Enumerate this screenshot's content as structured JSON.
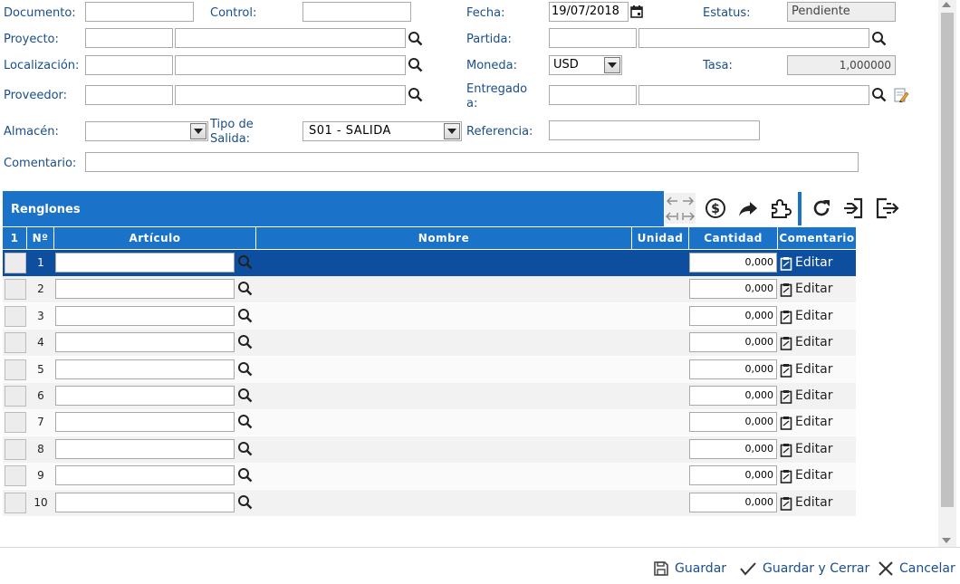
{
  "form": {
    "documento_label": "Documento:",
    "control_label": "Control:",
    "fecha_label": "Fecha:",
    "fecha_value": "19/07/2018",
    "estatus_label": "Estatus:",
    "estatus_value": "Pendiente",
    "proyecto_label": "Proyecto:",
    "partida_label": "Partida:",
    "localizacion_label": "Localización:",
    "moneda_label": "Moneda:",
    "moneda_value": "USD",
    "tasa_label": "Tasa:",
    "tasa_value": "1,000000",
    "proveedor_label": "Proveedor:",
    "entregado_label_1": "Entregado",
    "entregado_label_2": "a:",
    "almacen_label": "Almacén:",
    "tipo_salida_label_1": "Tipo de",
    "tipo_salida_label_2": "Salida:",
    "tipo_salida_value": "S01 - SALIDA",
    "referencia_label": "Referencia:",
    "comentario_label": "Comentario:"
  },
  "grid": {
    "title": "Renglones",
    "columns": {
      "sel": "1",
      "num": "Nº",
      "articulo": "Artículo",
      "nombre": "Nombre",
      "unidad": "Unidad",
      "cantidad": "Cantidad",
      "comentario": "Comentario"
    },
    "rows": [
      {
        "num": "1",
        "cantidad": "0,000",
        "edit": "Editar"
      },
      {
        "num": "2",
        "cantidad": "0,000",
        "edit": "Editar"
      },
      {
        "num": "3",
        "cantidad": "0,000",
        "edit": "Editar"
      },
      {
        "num": "4",
        "cantidad": "0,000",
        "edit": "Editar"
      },
      {
        "num": "5",
        "cantidad": "0,000",
        "edit": "Editar"
      },
      {
        "num": "6",
        "cantidad": "0,000",
        "edit": "Editar"
      },
      {
        "num": "7",
        "cantidad": "0,000",
        "edit": "Editar"
      },
      {
        "num": "8",
        "cantidad": "0,000",
        "edit": "Editar"
      },
      {
        "num": "9",
        "cantidad": "0,000",
        "edit": "Editar"
      },
      {
        "num": "10",
        "cantidad": "0,000",
        "edit": "Editar"
      }
    ]
  },
  "footer": {
    "guardar": "Guardar",
    "guardar_cerrar": "Guardar y Cerrar",
    "cancelar": "Cancelar"
  },
  "colors": {
    "accent": "#1a73c9",
    "selected_row": "#0d4e9e",
    "label": "#1a4e8a"
  }
}
